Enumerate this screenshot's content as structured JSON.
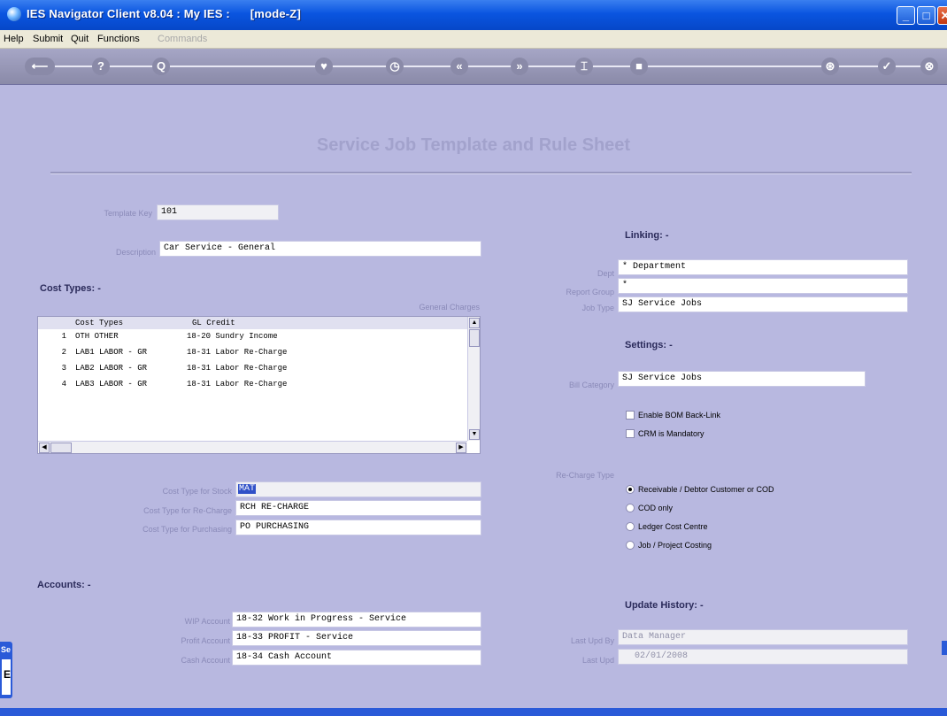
{
  "window": {
    "title": "IES Navigator Client v8.04 : My IES :      [mode-Z]"
  },
  "menu": [
    "Help",
    "Submit",
    "Quit",
    "Functions",
    "Commands"
  ],
  "toolbar": [
    "⟵",
    "?",
    "Q",
    "♥",
    "◷",
    "«",
    "»",
    "⌶",
    "■",
    "⊛",
    "✓",
    "⊗"
  ],
  "page": {
    "title": "Service Job Template and Rule Sheet"
  },
  "header": {
    "template_key_label": "Template Key",
    "template_key": "101",
    "description_label": "Description",
    "description": "Car Service - General"
  },
  "cost_types": {
    "heading": "Cost Types: -",
    "general_charges_label": "General Charges",
    "columns": [
      "Cost Types",
      "GL Credit"
    ],
    "rows": [
      {
        "n": "1",
        "ct": "OTH OTHER",
        "gl": "18-20 Sundry Income"
      },
      {
        "n": "2",
        "ct": "LAB1 LABOR - GR",
        "gl": "18-31 Labor Re-Charge"
      },
      {
        "n": "3",
        "ct": "LAB2 LABOR - GR",
        "gl": "18-31 Labor Re-Charge"
      },
      {
        "n": "4",
        "ct": "LAB3 LABOR - GR",
        "gl": "18-31 Labor Re-Charge"
      }
    ],
    "stock_label": "Cost Type for Stock",
    "stock": "MAT",
    "recharge_label": "Cost Type for Re-Charge",
    "recharge": "RCH RE-CHARGE",
    "purchasing_label": "Cost Type for Purchasing",
    "purchasing": "PO PURCHASING"
  },
  "accounts": {
    "heading": "Accounts: -",
    "wip_label": "WIP Account",
    "wip": "18-32 Work in Progress - Service",
    "profit_label": "Profit Account",
    "profit": "18-33 PROFIT - Service",
    "cash_label": "Cash Account",
    "cash": "18-34 Cash Account"
  },
  "linking": {
    "heading": "Linking: -",
    "dept_label": "Dept",
    "dept": "* Department",
    "report_group_label": "Report Group",
    "report_group": "*",
    "job_type_label": "Job Type",
    "job_type": "SJ Service Jobs"
  },
  "settings": {
    "heading": "Settings: -",
    "bill_category_label": "Bill Category",
    "bill_category": "SJ Service Jobs",
    "enable_bom": "Enable BOM Back-Link",
    "crm_mandatory": "CRM is Mandatory"
  },
  "recharge_type": {
    "label": "Re-Charge Type",
    "options": [
      "Receivable / Debtor Customer or COD",
      "COD only",
      "Ledger Cost Centre",
      "Job / Project Costing"
    ],
    "selected": "Receivable / Debtor Customer or COD"
  },
  "update_history": {
    "heading": "Update History: -",
    "last_upd_by_label": "Last Upd By",
    "last_upd_by": "Data Manager",
    "last_upd_label": "Last Upd",
    "last_upd": "02/01/2008"
  },
  "taskbar": {
    "tab_label": "Se",
    "tab_char": "E"
  }
}
